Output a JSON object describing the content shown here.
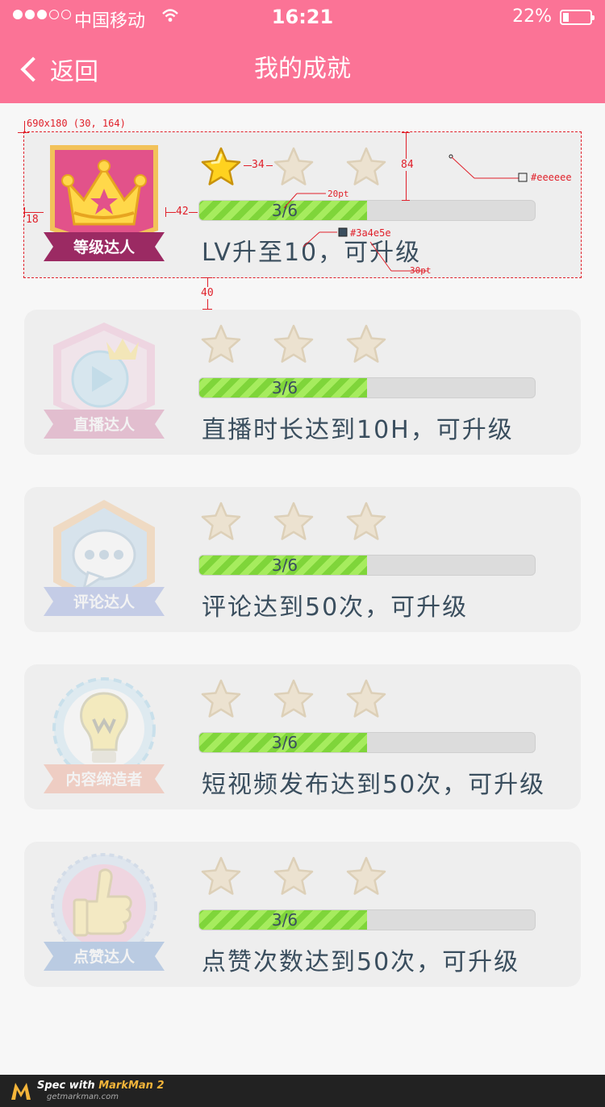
{
  "status_bar": {
    "carrier": "中国移动",
    "time": "16:21",
    "battery": "22%"
  },
  "nav": {
    "back_label": "返回",
    "title": "我的成就"
  },
  "achievements": [
    {
      "badge_label": "等级达人",
      "stars_earned": 1,
      "stars_total": 3,
      "progress": "3/6",
      "progress_fraction": 0.5,
      "description": "LV升至10，可升级",
      "active": true
    },
    {
      "badge_label": "直播达人",
      "stars_earned": 0,
      "stars_total": 3,
      "progress": "3/6",
      "progress_fraction": 0.5,
      "description": "直播时长达到10H，可升级",
      "active": false
    },
    {
      "badge_label": "评论达人",
      "stars_earned": 0,
      "stars_total": 3,
      "progress": "3/6",
      "progress_fraction": 0.5,
      "description": "评论达到50次，可升级",
      "active": false
    },
    {
      "badge_label": "内容缔造者",
      "stars_earned": 0,
      "stars_total": 3,
      "progress": "3/6",
      "progress_fraction": 0.5,
      "description": "短视频发布达到50次，可升级",
      "active": false
    },
    {
      "badge_label": "点赞达人",
      "stars_earned": 0,
      "stars_total": 3,
      "progress": "3/6",
      "progress_fraction": 0.5,
      "description": "点赞次数达到50次，可升级",
      "active": false
    }
  ],
  "annotations": {
    "frame": "690x180 (30, 164)",
    "star_gap": "34",
    "height": "84",
    "bg_color": "#eeeeee",
    "bar_font": "20pt",
    "text_color": "#3a4e5e",
    "text_font": "30pt",
    "left_gap": "42",
    "left_pad": "18",
    "card_gap": "40"
  },
  "footer": {
    "spec_prefix": "Spec with ",
    "product": "MarkMan 2",
    "site": "getmarkman.com"
  },
  "colors": {
    "accent": "#fb7396",
    "card_bg": "#eeeeee",
    "text": "#3a4e5e",
    "progress": "#7fd53a"
  }
}
